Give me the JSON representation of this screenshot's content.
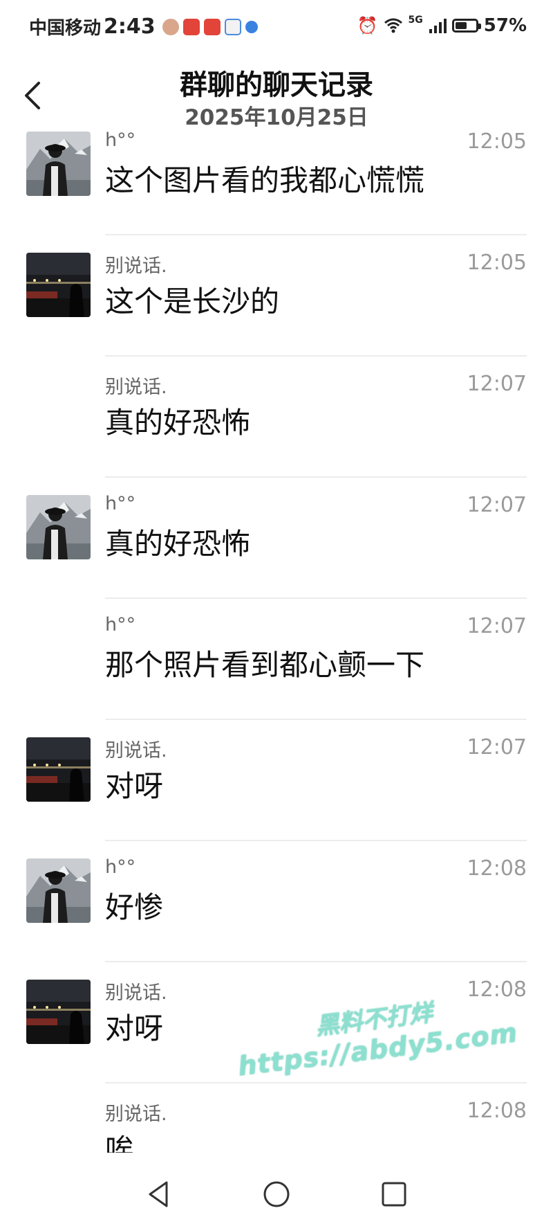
{
  "status_bar": {
    "carrier": "中国移动",
    "time": "2:43",
    "network": "5G",
    "battery_percent": "57%",
    "battery_level": 0.57,
    "icons": [
      "alarm-icon",
      "wifi-icon",
      "signal-icon",
      "battery-icon"
    ]
  },
  "header": {
    "title": "群聊的聊天记录",
    "date": "2025年10月25日",
    "back_icon": "chevron-left-icon"
  },
  "messages": [
    {
      "sender": "h°°",
      "time": "12:05",
      "text": "这个图片看的我都心慌慌",
      "avatar": "mountain-portrait"
    },
    {
      "sender": "别说话.",
      "time": "12:05",
      "text": "这个是长沙的",
      "avatar": "night-street"
    },
    {
      "sender": "别说话.",
      "time": "12:07",
      "text": "真的好恐怖",
      "avatar": ""
    },
    {
      "sender": "h°°",
      "time": "12:07",
      "text": "真的好恐怖",
      "avatar": "mountain-portrait"
    },
    {
      "sender": "h°°",
      "time": "12:07",
      "text": "那个照片看到都心颤一下",
      "avatar": ""
    },
    {
      "sender": "别说话.",
      "time": "12:07",
      "text": "对呀",
      "avatar": "night-street"
    },
    {
      "sender": "h°°",
      "time": "12:08",
      "text": "好惨",
      "avatar": "mountain-portrait"
    },
    {
      "sender": "别说话.",
      "time": "12:08",
      "text": "对呀",
      "avatar": "night-street"
    },
    {
      "sender": "别说话.",
      "time": "12:08",
      "text": "唉",
      "avatar": ""
    }
  ],
  "watermark": {
    "line1": "黑料不打烊",
    "line2": "https://abdy5.com"
  },
  "nav_bar": {
    "icons": [
      "nav-back-icon",
      "nav-home-icon",
      "nav-recents-icon"
    ]
  }
}
